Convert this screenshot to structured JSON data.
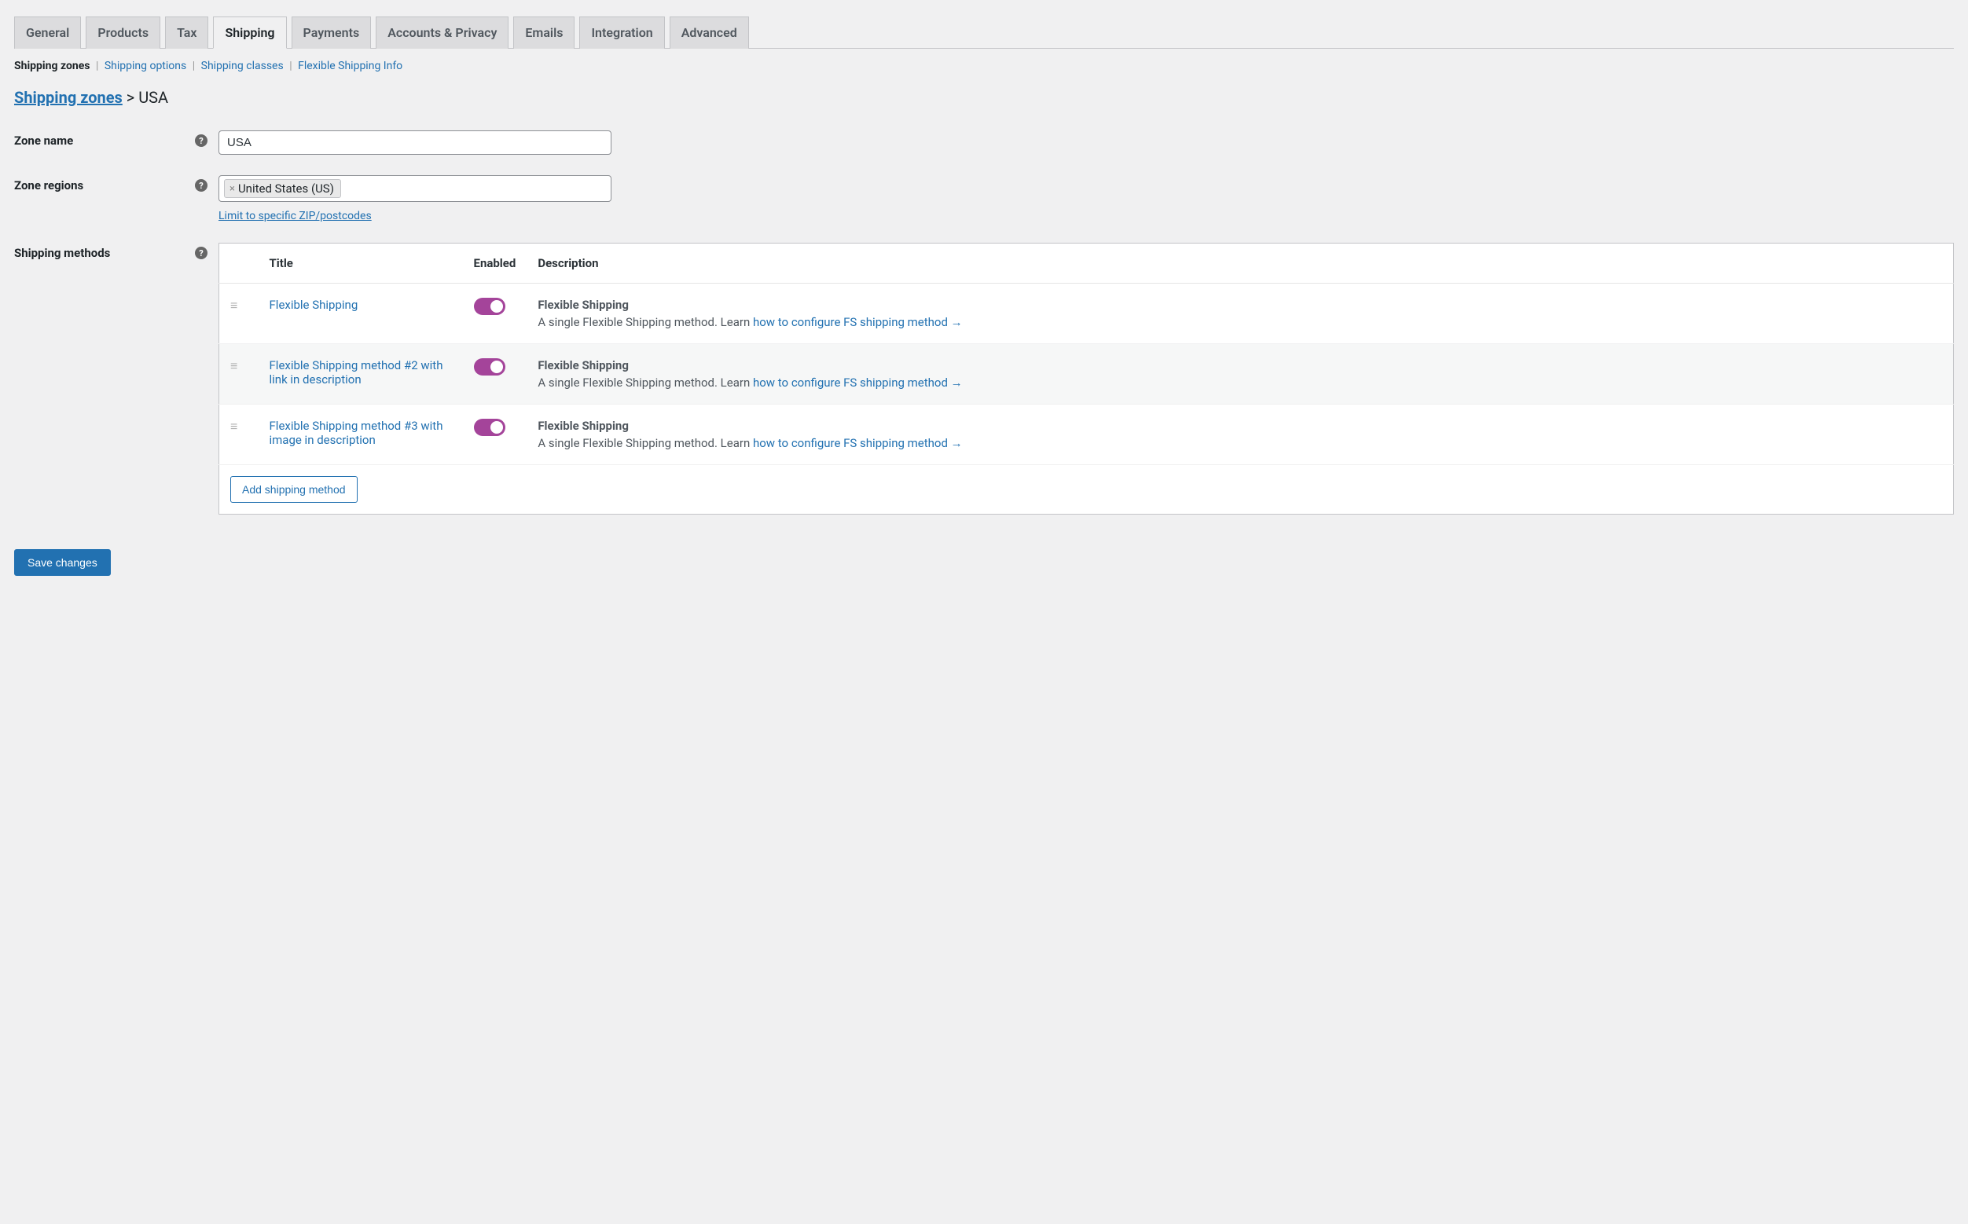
{
  "tabs": {
    "items": [
      {
        "label": "General",
        "active": false
      },
      {
        "label": "Products",
        "active": false
      },
      {
        "label": "Tax",
        "active": false
      },
      {
        "label": "Shipping",
        "active": true
      },
      {
        "label": "Payments",
        "active": false
      },
      {
        "label": "Accounts & Privacy",
        "active": false
      },
      {
        "label": "Emails",
        "active": false
      },
      {
        "label": "Integration",
        "active": false
      },
      {
        "label": "Advanced",
        "active": false
      }
    ]
  },
  "subnav": {
    "items": [
      {
        "label": "Shipping zones",
        "current": true
      },
      {
        "label": "Shipping options",
        "current": false
      },
      {
        "label": "Shipping classes",
        "current": false
      },
      {
        "label": "Flexible Shipping Info",
        "current": false
      }
    ]
  },
  "breadcrumb": {
    "root": "Shipping zones",
    "separator": " > ",
    "leaf": "USA"
  },
  "fields": {
    "zone_name": {
      "label": "Zone name",
      "value": "USA"
    },
    "zone_regions": {
      "label": "Zone regions",
      "chip": "United States (US)",
      "limit_link": "Limit to specific ZIP/postcodes"
    },
    "shipping_methods_label": "Shipping methods"
  },
  "table": {
    "headers": {
      "title": "Title",
      "enabled": "Enabled",
      "description": "Description"
    },
    "rows": [
      {
        "title": "Flexible Shipping",
        "enabled": true,
        "desc_heading": "Flexible Shipping",
        "desc_text": "A single Flexible Shipping method. Learn ",
        "desc_link": "how to configure FS shipping method",
        "desc_arrow": " →"
      },
      {
        "title": "Flexible Shipping method #2 with link in description",
        "enabled": true,
        "desc_heading": "Flexible Shipping",
        "desc_text": "A single Flexible Shipping method. Learn ",
        "desc_link": "how to configure FS shipping method",
        "desc_arrow": " →"
      },
      {
        "title": "Flexible Shipping method #3 with image in description",
        "enabled": true,
        "desc_heading": "Flexible Shipping",
        "desc_text": "A single Flexible Shipping method. Learn ",
        "desc_link": "how to configure FS shipping method",
        "desc_arrow": " →"
      }
    ],
    "add_button": "Add shipping method"
  },
  "save_button": "Save changes"
}
